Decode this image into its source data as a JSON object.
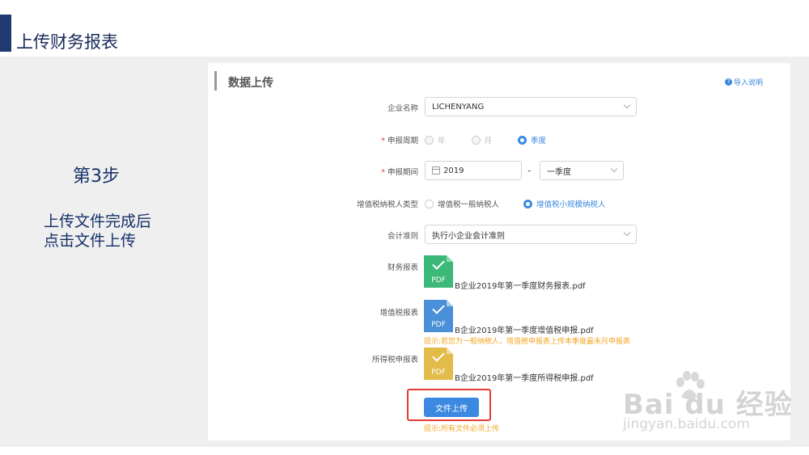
{
  "slide": {
    "title": "上传财务报表",
    "step_title": "第3步",
    "step_desc_line1": "上传文件完成后",
    "step_desc_line2": "点击文件上传"
  },
  "panel": {
    "heading": "数据上传",
    "help_link": "导入说明",
    "company": {
      "label": "企业名称",
      "value": "LICHENYANG"
    },
    "period_type": {
      "label": "申报周期",
      "options": [
        "年",
        "月",
        "季度"
      ],
      "selected": "季度"
    },
    "period": {
      "label": "申报期间",
      "year": "2019",
      "separator": "-",
      "quarter": "一季度"
    },
    "taxpayer_type": {
      "label": "增值税纳税人类型",
      "options": [
        "增值税一般纳税人",
        "增值税小规模纳税人"
      ],
      "selected": "增值税小规模纳税人"
    },
    "accounting_standard": {
      "label": "会计准则",
      "value": "执行小企业会计准则"
    },
    "files": [
      {
        "label": "财务报表",
        "icon_text": "PDF",
        "filename": "B企业2019年第一季度财务报表.pdf",
        "color": "#3cb878"
      },
      {
        "label": "增值税报表",
        "icon_text": "PDF",
        "filename": "B企业2019年第一季度增值税申报.pdf",
        "color": "#4a90d9",
        "hint": "提示:若您为一般纳税人，增值税申报表上传本季度最末月申报表"
      },
      {
        "label": "所得税申报表",
        "icon_text": "PDF",
        "filename": "B企业2019年第一季度所得税申报.pdf",
        "color": "#e3bb4a"
      }
    ],
    "upload_button": "文件上传",
    "upload_hint": "提示:所有文件必须上传"
  },
  "watermark": {
    "main": "Bai du 经验",
    "sub": "jingyan.baidu.com"
  },
  "colors": {
    "accent": "#3b89e0",
    "warning": "#f5a623",
    "required": "#e53935",
    "highlight_box": "#e53935"
  }
}
